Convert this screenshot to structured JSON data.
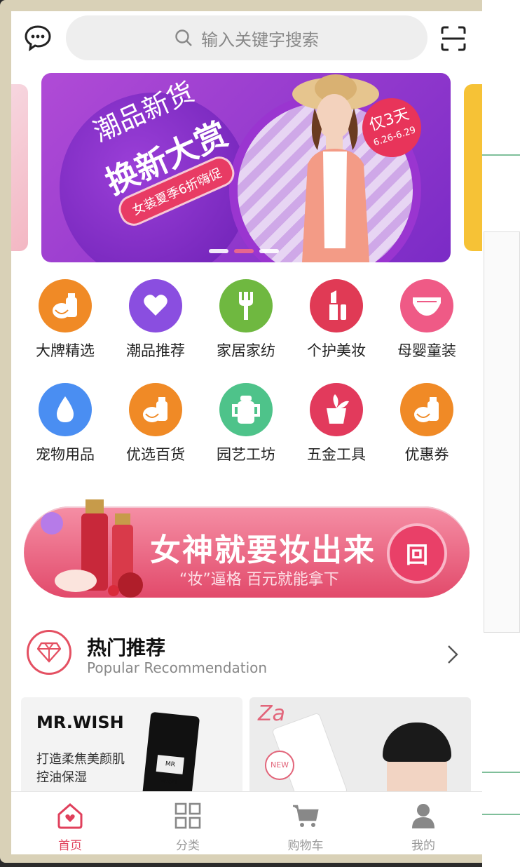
{
  "search": {
    "placeholder": "输入关键字搜索"
  },
  "banner": {
    "line1": "潮品新货",
    "line2": "换新大赏",
    "pill": "女装夏季6折嗨促",
    "tag_main": "仅3天",
    "tag_dates": "6.26-6.29"
  },
  "categories": [
    {
      "label": "大牌精选",
      "color": "#f08a26",
      "icon": "fruit-bottle-icon"
    },
    {
      "label": "潮品推荐",
      "color": "#8a4ee0",
      "icon": "heart-icon"
    },
    {
      "label": "家居家纺",
      "color": "#6fb840",
      "icon": "fork-icon"
    },
    {
      "label": "个护美妆",
      "color": "#e03a55",
      "icon": "lipstick-icon"
    },
    {
      "label": "母婴童装",
      "color": "#ef5a86",
      "icon": "diaper-icon"
    },
    {
      "label": "宠物用品",
      "color": "#4a8ef2",
      "icon": "water-drop-icon"
    },
    {
      "label": "优选百货",
      "color": "#f08a26",
      "icon": "fruit-bottle-icon"
    },
    {
      "label": "园艺工坊",
      "color": "#4ec38a",
      "icon": "sippy-cup-icon"
    },
    {
      "label": "五金工具",
      "color": "#e23a5c",
      "icon": "plant-pot-icon"
    },
    {
      "label": "优惠券",
      "color": "#f08a26",
      "icon": "fruit-bottle-icon"
    }
  ],
  "promo": {
    "title": "女神就要妆出来",
    "subtitle": "“妆”逼格 百元就能拿下",
    "badge": "回"
  },
  "section": {
    "title": "热门推荐",
    "subtitle": "Popular Recommendation"
  },
  "products": [
    {
      "brand": "MR.WISH",
      "desc": "打造柔焦美颜肌 控油保湿"
    },
    {
      "brand": "Za",
      "badge": "NEW"
    }
  ],
  "tabs": [
    {
      "label": "首页",
      "icon": "home-icon",
      "active": true
    },
    {
      "label": "分类",
      "icon": "grid-icon",
      "active": false
    },
    {
      "label": "购物车",
      "icon": "cart-icon",
      "active": false
    },
    {
      "label": "我的",
      "icon": "user-icon",
      "active": false
    }
  ],
  "colors": {
    "accent": "#e0405c",
    "banner": "#8a34cc"
  }
}
